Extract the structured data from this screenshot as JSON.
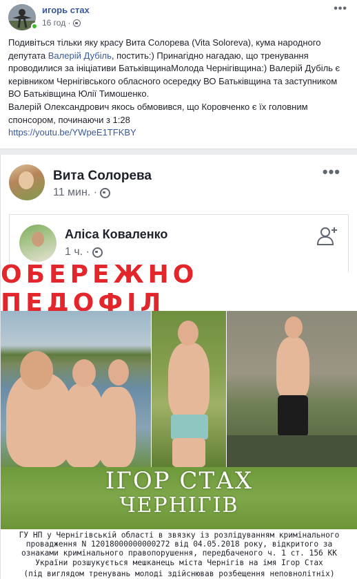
{
  "post": {
    "author": "игорь стах",
    "time": "16 год ·",
    "more": "•••",
    "text_part1": "Подивіться тільки яку красу Вита Солорева (Vita Soloreva), кума народного депутата ",
    "mention": "Валерій Дубіль",
    "text_part2": ", постить:) Принагідно нагадаю, що тренування проводилися за ініціативи БатьківщинаМолода Чернігівщина:) Валерій Дубіль є керівником Чернігівського обласного осередку ВО Батьківщина та заступником ВО Батьківщина Юлії Тимошенко.",
    "text_part3": "Валерій Олександрович якось обмовився, що Коровченко є їх головним спонсором, починаючи з 1:28",
    "link": "https://youtu.be/YWpeE1TFKBY"
  },
  "shared": {
    "author": "Вита Солорева",
    "time": "11 мин. ·",
    "more": "•••",
    "inner": {
      "author": "Аліса Коваленко",
      "time": "1 ч. ·"
    },
    "poster": {
      "banner": "ОБЕРЕЖНО ПЕДОФІЛ",
      "caption_name": "ІГОР СТАХ",
      "caption_city": "ЧЕРНІГІВ",
      "notice": "ГУ НП у Чернігівській області в звязку із розлідуванням кримінального провадження N 12018000000000272 від 04.05.2018 року, відкритого за ознаками кримінального правопорушення, передбаченого ч. 1 ст. 156 КК України розшукується мешканець міста Чернігів на імя Ігор Стах",
      "notice2": "(під виглядом тренувань молоді здійснював розбещення неповнолітніх)"
    }
  }
}
